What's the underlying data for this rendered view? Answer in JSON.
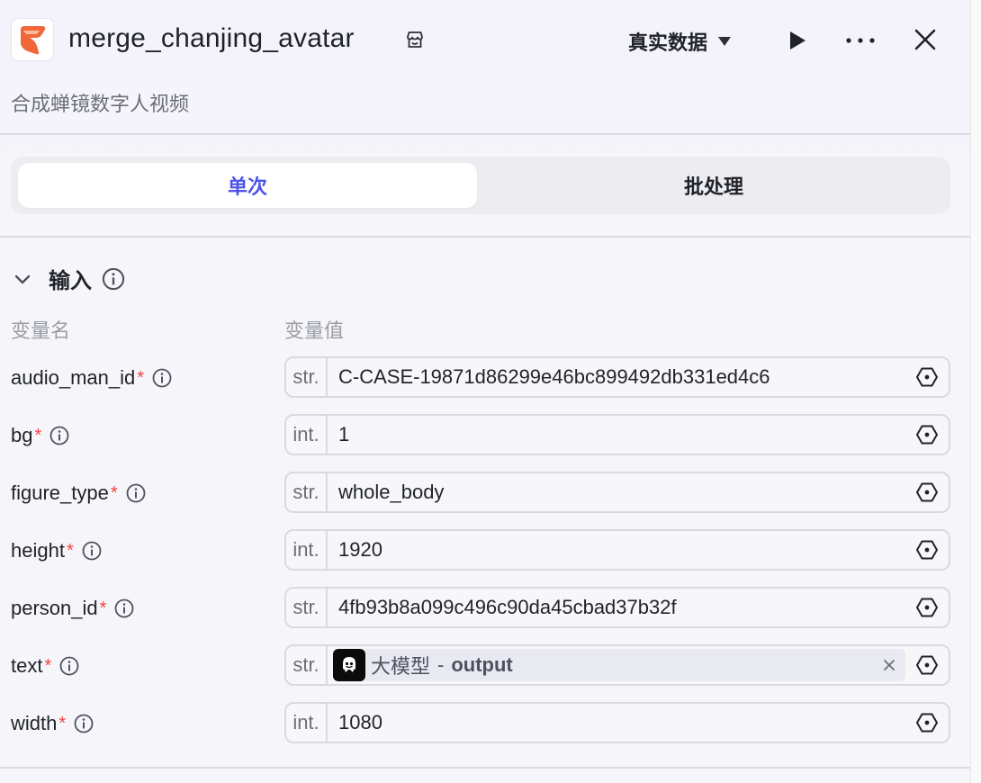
{
  "header": {
    "title": "merge_chanjing_avatar",
    "subtitle": "合成蝉镜数字人视频",
    "dataset_selector": "真实数据"
  },
  "tabs": [
    {
      "label": "单次",
      "active": true
    },
    {
      "label": "批处理",
      "active": false
    }
  ],
  "input_section": {
    "title": "输入",
    "col_name": "变量名",
    "col_value": "变量值",
    "params": [
      {
        "name": "audio_man_id",
        "required": "*",
        "type": "str.",
        "value": "C-CASE-19871d86299e46bc899492db331ed4c6"
      },
      {
        "name": "bg",
        "required": "*",
        "type": "int.",
        "value": "1"
      },
      {
        "name": "figure_type",
        "required": "*",
        "type": "str.",
        "value": "whole_body"
      },
      {
        "name": "height",
        "required": "*",
        "type": "int.",
        "value": "1920"
      },
      {
        "name": "person_id",
        "required": "*",
        "type": "str.",
        "value": "4fb93b8a099c496c90da45cbad37b32f"
      },
      {
        "name": "text",
        "required": "*",
        "type": "str.",
        "ref_node": "大模型",
        "ref_sep": "-",
        "ref_output": "output"
      },
      {
        "name": "width",
        "required": "*",
        "type": "int.",
        "value": "1080"
      }
    ]
  },
  "colors": {
    "accent": "#4d53e8",
    "required": "#f53f3f",
    "logo": "#f0683a"
  }
}
